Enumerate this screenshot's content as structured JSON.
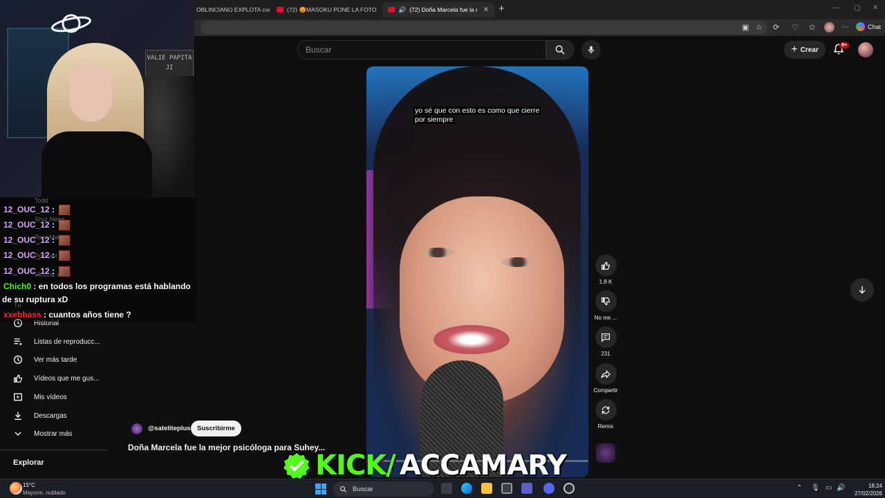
{
  "browser": {
    "tabs": [
      {
        "title": "OBLINCIANO EXPLOTA cont..."
      },
      {
        "title": "(72) 😡MASOKU PONE LA FOTO"
      },
      {
        "title": "(72) Doña Marcela fue la mejo..."
      }
    ],
    "new_tab_glyph": "+",
    "chat_label": "Chat"
  },
  "youtube": {
    "search_placeholder": "Buscar",
    "create_label": "Crear",
    "notification_badge": "9+",
    "sidebar": {
      "items": [
        {
          "label": "Historial",
          "icon": "history-icon"
        },
        {
          "label": "Listas de reproducc...",
          "icon": "playlist-icon"
        },
        {
          "label": "Ver más tarde",
          "icon": "clock-icon"
        },
        {
          "label": "Vídeos que me gus...",
          "icon": "like-icon"
        },
        {
          "label": "Mis vídeos",
          "icon": "play-square-icon"
        },
        {
          "label": "Descargas",
          "icon": "download-icon"
        },
        {
          "label": "Mostrar más",
          "icon": "chevron-down-icon"
        }
      ],
      "explore_heading": "Explorar"
    },
    "short": {
      "subtitle": "yo sé que con esto es como que cierre por siempre",
      "channel": "@sateliteplus",
      "subscribe_label": "Suscribirme",
      "title": "Doña Marcela fue la mejor psicóloga para Suhey...",
      "progress": 0.08,
      "actions": {
        "likes": "1,8 K",
        "dislike_label": "No me ...",
        "comments": "231",
        "share_label": "Compartir",
        "remix_label": "Remix"
      }
    }
  },
  "webcam": {
    "sign_text": "VALIE PAPITA JI"
  },
  "chat": {
    "faded_sidebar": [
      "Todd",
      "Shur News",
      "Real Madrid",
      "Podcast TV",
      "Mostrar más",
      "Tú"
    ],
    "messages": [
      {
        "user": "12_OUC_12",
        "text": "",
        "color": "#d9a6ff"
      },
      {
        "user": "12_OUC_12",
        "text": "",
        "color": "#d9a6ff"
      },
      {
        "user": "12_OUC_12",
        "text": "",
        "color": "#d9a6ff"
      },
      {
        "user": "12_OUC_12",
        "text": "",
        "color": "#d9a6ff"
      },
      {
        "user": "12_OUC_12",
        "text": "",
        "color": "#d9a6ff"
      },
      {
        "user": "Chich0",
        "text": "en todos los programas está hablando",
        "color": "#53fc18"
      },
      {
        "user": "",
        "text": "de su ruptura xD",
        "color": "#ffffff"
      },
      {
        "user": "xxebbass",
        "text": "cuantos años tiene ?",
        "color": "#ff2b2b"
      }
    ]
  },
  "watermark": {
    "part1": "KICK/",
    "part2": "ACCAMARY",
    "brand_color": "#53fc18"
  },
  "taskbar": {
    "temperature": "15°C",
    "weather": "Mayorm. nublado",
    "search_label": "Buscar",
    "time": "18:24",
    "date": "27/02/2026"
  }
}
